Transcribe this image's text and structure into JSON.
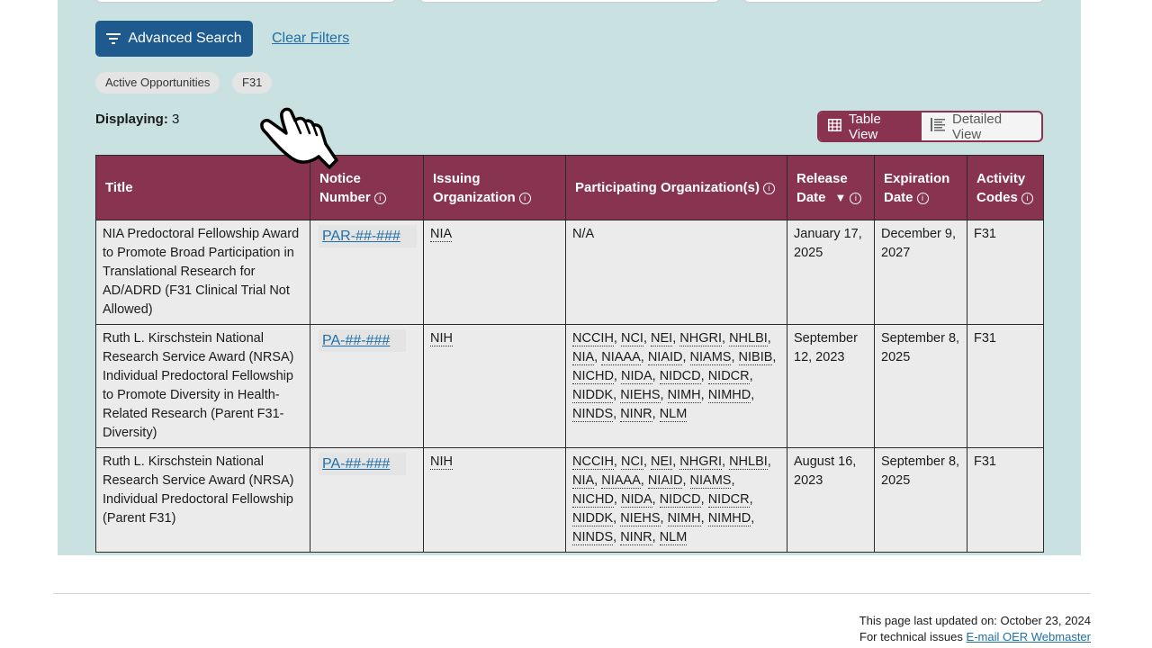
{
  "filters": {
    "advanced_search_label": "Advanced Search",
    "clear_filters_label": "Clear Filters",
    "chips": [
      "Active Opportunities",
      "F31"
    ]
  },
  "results": {
    "displaying_label": "Displaying:",
    "displaying_count": "3"
  },
  "view_toggle": {
    "table_view_label": "Table View",
    "detailed_view_label": "Detailed View",
    "active": "Table View"
  },
  "table": {
    "headers": {
      "title": "Title",
      "notice_number": "Notice Number",
      "issuing_org": "Issuing Organization",
      "participating_orgs": "Participating Organization(s)",
      "release_date": "Release Date",
      "expiration_date": "Expiration Date",
      "activity_codes": "Activity Codes"
    },
    "sort_indicator": "▼",
    "rows": [
      {
        "title": "NIA Predoctoral Fellowship Award to Promote Broad Participation in Translational Research for AD/ADRD (F31 Clinical Trial Not Allowed)",
        "notice_number": "PAR-##-###",
        "issuing_org": "NIA",
        "participating_orgs": [
          "N/A"
        ],
        "release_date": "January 17, 2025",
        "expiration_date": "December 9, 2027",
        "activity_code": "F31"
      },
      {
        "title": "Ruth L. Kirschstein National Research Service Award (NRSA) Individual Predoctoral Fellowship to Promote Diversity in Health-Related Research (Parent F31-Diversity)",
        "notice_number": "PA-##-###",
        "issuing_org": "NIH",
        "participating_orgs": [
          "NCCIH",
          "NCI",
          "NEI",
          "NHGRI",
          "NHLBI",
          "NIA",
          "NIAAA",
          "NIAID",
          "NIAMS",
          "NIBIB",
          "NICHD",
          "NIDA",
          "NIDCD",
          "NIDCR",
          "NIDDK",
          "NIEHS",
          "NIMH",
          "NIMHD",
          "NINDS",
          "NINR",
          "NLM"
        ],
        "release_date": "September 12, 2023",
        "expiration_date": "September 8, 2025",
        "activity_code": "F31"
      },
      {
        "title": "Ruth L. Kirschstein National Research Service Award (NRSA) Individual Predoctoral Fellowship (Parent F31)",
        "notice_number": "PA-##-###",
        "issuing_org": "NIH",
        "participating_orgs": [
          "NCCIH",
          "NCI",
          "NEI",
          "NHGRI",
          "NHLBI",
          "NIA",
          "NIAAA",
          "NIAID",
          "NIAMS",
          "NICHD",
          "NIDA",
          "NIDCD",
          "NIDCR",
          "NIDDK",
          "NIEHS",
          "NIMH",
          "NIMHD",
          "NINDS",
          "NINR",
          "NLM"
        ],
        "release_date": "August 16, 2023",
        "expiration_date": "September 8, 2025",
        "activity_code": "F31"
      }
    ]
  },
  "footer": {
    "last_updated": "This page last updated on: October 23, 2024",
    "technical_issues_label": "For technical issues",
    "webmaster_link": "E-mail OER Webmaster"
  },
  "icons": {
    "filter": "filter-lines-icon",
    "table_view": "grid-table-icon",
    "detailed_view": "list-detail-icon",
    "info": "info-circle-icon",
    "cursor": "hand-pointer-icon"
  },
  "colors": {
    "panel_bg": "#c9e1e0",
    "primary_button": "#1f5a8f",
    "table_header": "#883350",
    "link": "#1f6fa8"
  }
}
